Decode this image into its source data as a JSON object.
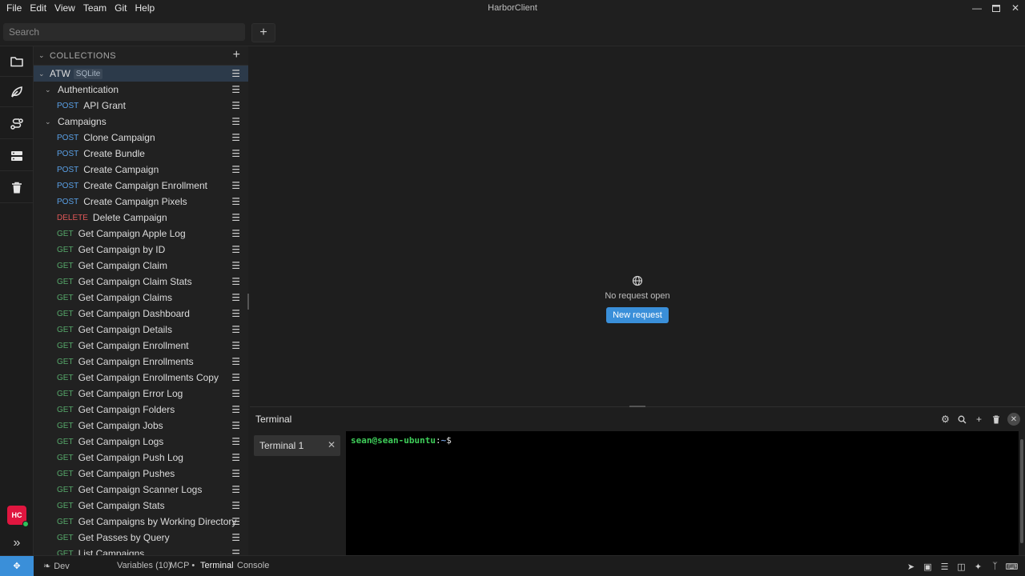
{
  "app": {
    "title": "HarborClient",
    "menu": [
      "File",
      "Edit",
      "View",
      "Team",
      "Git",
      "Help"
    ]
  },
  "search": {
    "placeholder": "Search"
  },
  "sidebar": {
    "collections_label": "COLLECTIONS",
    "workspace": {
      "name": "ATW",
      "badge": "SQLite"
    },
    "folders": [
      {
        "name": "Authentication",
        "requests": [
          {
            "method": "POST",
            "name": "API Grant"
          }
        ]
      },
      {
        "name": "Campaigns",
        "requests": [
          {
            "method": "POST",
            "name": "Clone Campaign"
          },
          {
            "method": "POST",
            "name": "Create Bundle"
          },
          {
            "method": "POST",
            "name": "Create Campaign"
          },
          {
            "method": "POST",
            "name": "Create Campaign Enrollment"
          },
          {
            "method": "POST",
            "name": "Create Campaign Pixels"
          },
          {
            "method": "DELETE",
            "name": "Delete Campaign"
          },
          {
            "method": "GET",
            "name": "Get Campaign Apple Log"
          },
          {
            "method": "GET",
            "name": "Get Campaign by ID"
          },
          {
            "method": "GET",
            "name": "Get Campaign Claim"
          },
          {
            "method": "GET",
            "name": "Get Campaign Claim Stats"
          },
          {
            "method": "GET",
            "name": "Get Campaign Claims"
          },
          {
            "method": "GET",
            "name": "Get Campaign Dashboard"
          },
          {
            "method": "GET",
            "name": "Get Campaign Details"
          },
          {
            "method": "GET",
            "name": "Get Campaign Enrollment"
          },
          {
            "method": "GET",
            "name": "Get Campaign Enrollments"
          },
          {
            "method": "GET",
            "name": "Get Campaign Enrollments Copy"
          },
          {
            "method": "GET",
            "name": "Get Campaign Error Log"
          },
          {
            "method": "GET",
            "name": "Get Campaign Folders"
          },
          {
            "method": "GET",
            "name": "Get Campaign Jobs"
          },
          {
            "method": "GET",
            "name": "Get Campaign Logs"
          },
          {
            "method": "GET",
            "name": "Get Campaign Push Log"
          },
          {
            "method": "GET",
            "name": "Get Campaign Pushes"
          },
          {
            "method": "GET",
            "name": "Get Campaign Scanner Logs"
          },
          {
            "method": "GET",
            "name": "Get Campaign Stats"
          },
          {
            "method": "GET",
            "name": "Get Campaigns by Working Directory"
          },
          {
            "method": "GET",
            "name": "Get Passes by Query"
          },
          {
            "method": "GET",
            "name": "List Campaigns"
          }
        ]
      }
    ]
  },
  "main": {
    "empty_text": "No request open",
    "new_request_label": "New request"
  },
  "terminal": {
    "title": "Terminal",
    "tab_label": "Terminal 1",
    "prompt_user": "sean@sean-ubuntu",
    "prompt_sep": ":",
    "prompt_path": "~",
    "prompt_symbol": "$"
  },
  "user": {
    "initials": "HC"
  },
  "status": {
    "environment": "Dev",
    "variables": "Variables (10)",
    "mcp": "MCP",
    "terminal": "Terminal",
    "console": "Console"
  },
  "colors": {
    "accent": "#3a8fd9",
    "post": "#5aa0e6",
    "get": "#56a86a",
    "delete": "#e05858",
    "avatar": "#e0163f"
  }
}
